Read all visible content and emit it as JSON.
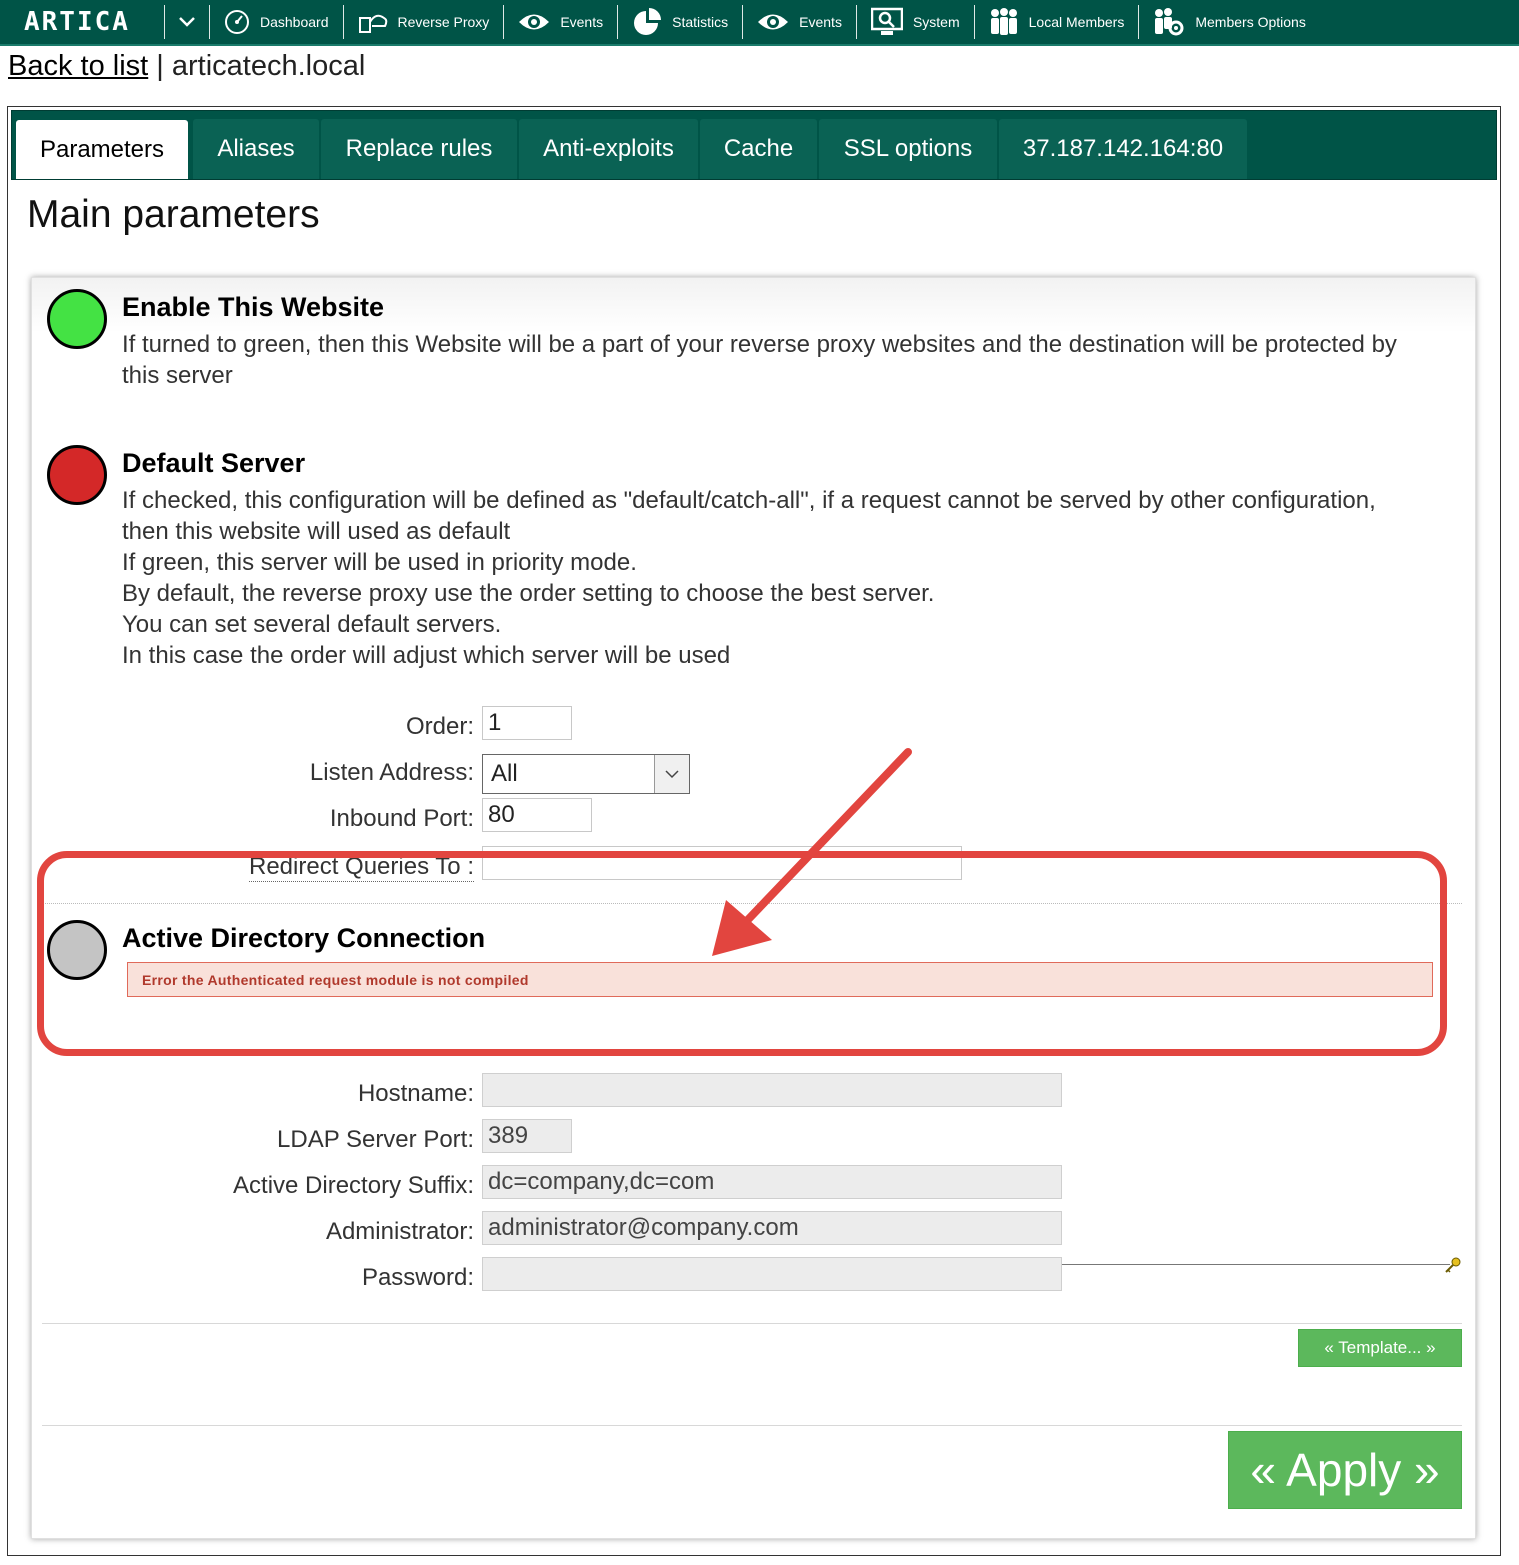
{
  "nav": {
    "brand": "ARTICA",
    "items": [
      {
        "label": "Dashboard",
        "icon": "dashboard-gauge-icon"
      },
      {
        "label": "Reverse Proxy",
        "icon": "reverse-proxy-icon"
      },
      {
        "label": "Events",
        "icon": "eye-icon"
      },
      {
        "label": "Statistics",
        "icon": "pie-chart-icon"
      },
      {
        "label": "Events",
        "icon": "eye-icon"
      },
      {
        "label": "System",
        "icon": "monitor-search-icon"
      },
      {
        "label": "Local Members",
        "icon": "users-group-icon"
      },
      {
        "label": "Members Options",
        "icon": "users-gear-icon"
      }
    ]
  },
  "breadcrumb": {
    "back_label": "Back to list",
    "separator": "|",
    "site": "articatech.local"
  },
  "tabs": [
    {
      "label": "Parameters",
      "active": true
    },
    {
      "label": "Aliases"
    },
    {
      "label": "Replace rules"
    },
    {
      "label": "Anti-exploits"
    },
    {
      "label": "Cache"
    },
    {
      "label": "SSL options"
    },
    {
      "label": "37.187.142.164:80"
    }
  ],
  "main_title": "Main parameters",
  "enable_website": {
    "title": "Enable This Website",
    "text": "If turned to green, then this Website will be a part of your reverse proxy websites and the destination will be protected by this server",
    "state": "on",
    "color": "#44e244"
  },
  "default_server": {
    "title": "Default Server",
    "lines": [
      "If checked, this configuration will be defined as \"default/catch-all\", if a request cannot be served by other configuration, then this website will used as default",
      "If green, this server will be used in priority mode.",
      "By default, the reverse proxy use the order setting to choose the best server.",
      "You can set several default servers.",
      "In this case the order will adjust which server will be used"
    ],
    "state": "off",
    "color": "#d42828"
  },
  "fields": {
    "order": {
      "label": "Order:",
      "value": "1"
    },
    "listen_address": {
      "label": "Listen Address:",
      "value": "All"
    },
    "inbound_port": {
      "label": "Inbound Port:",
      "value": "80"
    },
    "redirect": {
      "label": "Redirect Queries To :",
      "value": ""
    }
  },
  "active_directory": {
    "title": "Active Directory Connection",
    "state": "disabled",
    "color": "#c4c4c4",
    "error": "Error the Authenticated request module is not compiled",
    "hostname": {
      "label": "Hostname:",
      "value": ""
    },
    "ldap_port": {
      "label": "LDAP Server Port:",
      "value": "389"
    },
    "suffix": {
      "label": "Active Directory Suffix:",
      "value": "dc=company,dc=com"
    },
    "administrator": {
      "label": "Administrator:",
      "value": "administrator@company.com"
    },
    "password": {
      "label": "Password:",
      "value": ""
    }
  },
  "buttons": {
    "template": "« Template... »",
    "apply": "« Apply »"
  },
  "colors": {
    "nav_bg": "#005447",
    "accent_green": "#5cb85c",
    "annotation_red": "#e2453f",
    "error_bg": "#f9e1da",
    "error_text": "#b0392c"
  }
}
